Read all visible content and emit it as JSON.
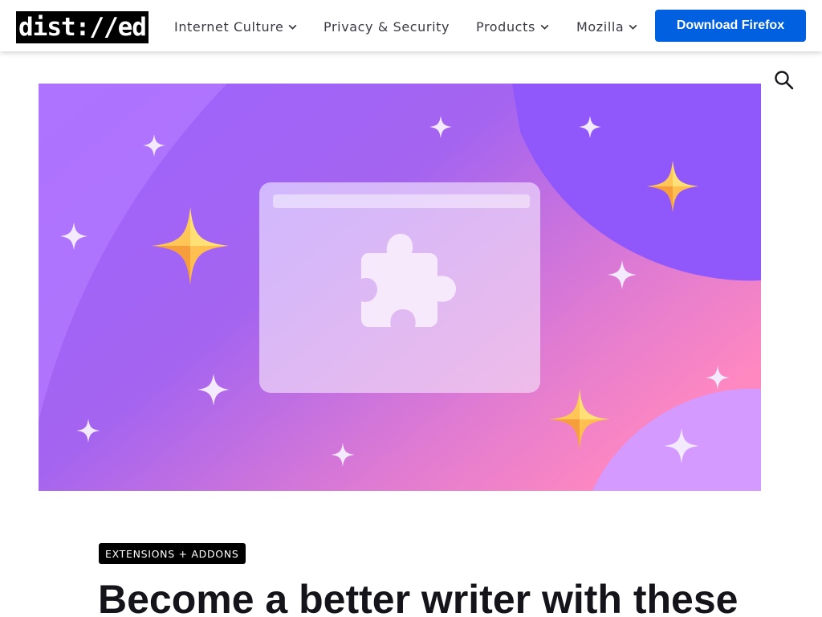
{
  "header": {
    "logo_text": "dist://ed",
    "nav": [
      {
        "label": "Internet Culture",
        "has_dropdown": true
      },
      {
        "label": "Privacy & Security",
        "has_dropdown": false
      },
      {
        "label": "Products",
        "has_dropdown": true
      },
      {
        "label": "Mozilla",
        "has_dropdown": true
      }
    ],
    "cta_label": "Download Firefox"
  },
  "search": {
    "icon": "search-icon"
  },
  "hero": {
    "icon": "puzzle-piece-icon"
  },
  "article": {
    "category": "EXTENSIONS + ADDONS",
    "title": "Become a better writer with these"
  },
  "colors": {
    "cta": "#0060df",
    "hero_purple": "#9059ff",
    "hero_pink": "#ff8ac5",
    "sparkle_gold": "#ffbd4f"
  }
}
